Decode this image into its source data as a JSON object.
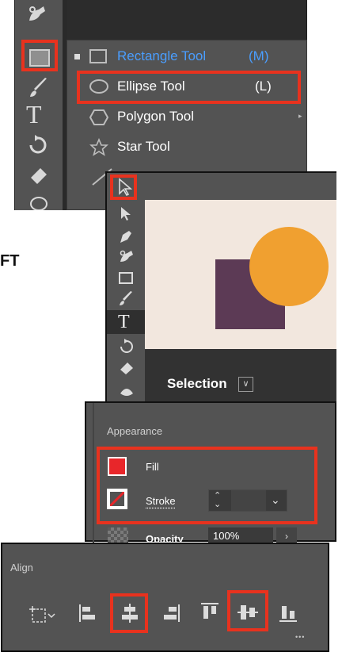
{
  "left_edge_text": "FT",
  "shape_menu": {
    "items": [
      {
        "label": "Rectangle Tool",
        "shortcut": "(M)",
        "icon": "rectangle-icon",
        "active": true
      },
      {
        "label": "Ellipse Tool",
        "shortcut": "(L)",
        "icon": "ellipse-icon",
        "highlighted": true
      },
      {
        "label": "Polygon Tool",
        "shortcut": "",
        "icon": "polygon-icon"
      },
      {
        "label": "Star Tool",
        "shortcut": "",
        "icon": "star-icon"
      }
    ],
    "active_color": "#4a9eff"
  },
  "canvas_panel": {
    "artboard_color": "#f2e7de",
    "square_color": "#5c3a55",
    "circle_color": "#f0a030",
    "selection_label": "Selection"
  },
  "appearance": {
    "title": "Appearance",
    "fill_label": "Fill",
    "fill_color": "#e8262a",
    "stroke_label": "Stroke",
    "opacity_label": "Opacity",
    "opacity_value": "100%"
  },
  "align": {
    "title": "Align",
    "more": "•••"
  },
  "colors": {
    "panel_bg": "#535353",
    "dark_bg": "#323232",
    "highlight": "#e8321e"
  }
}
